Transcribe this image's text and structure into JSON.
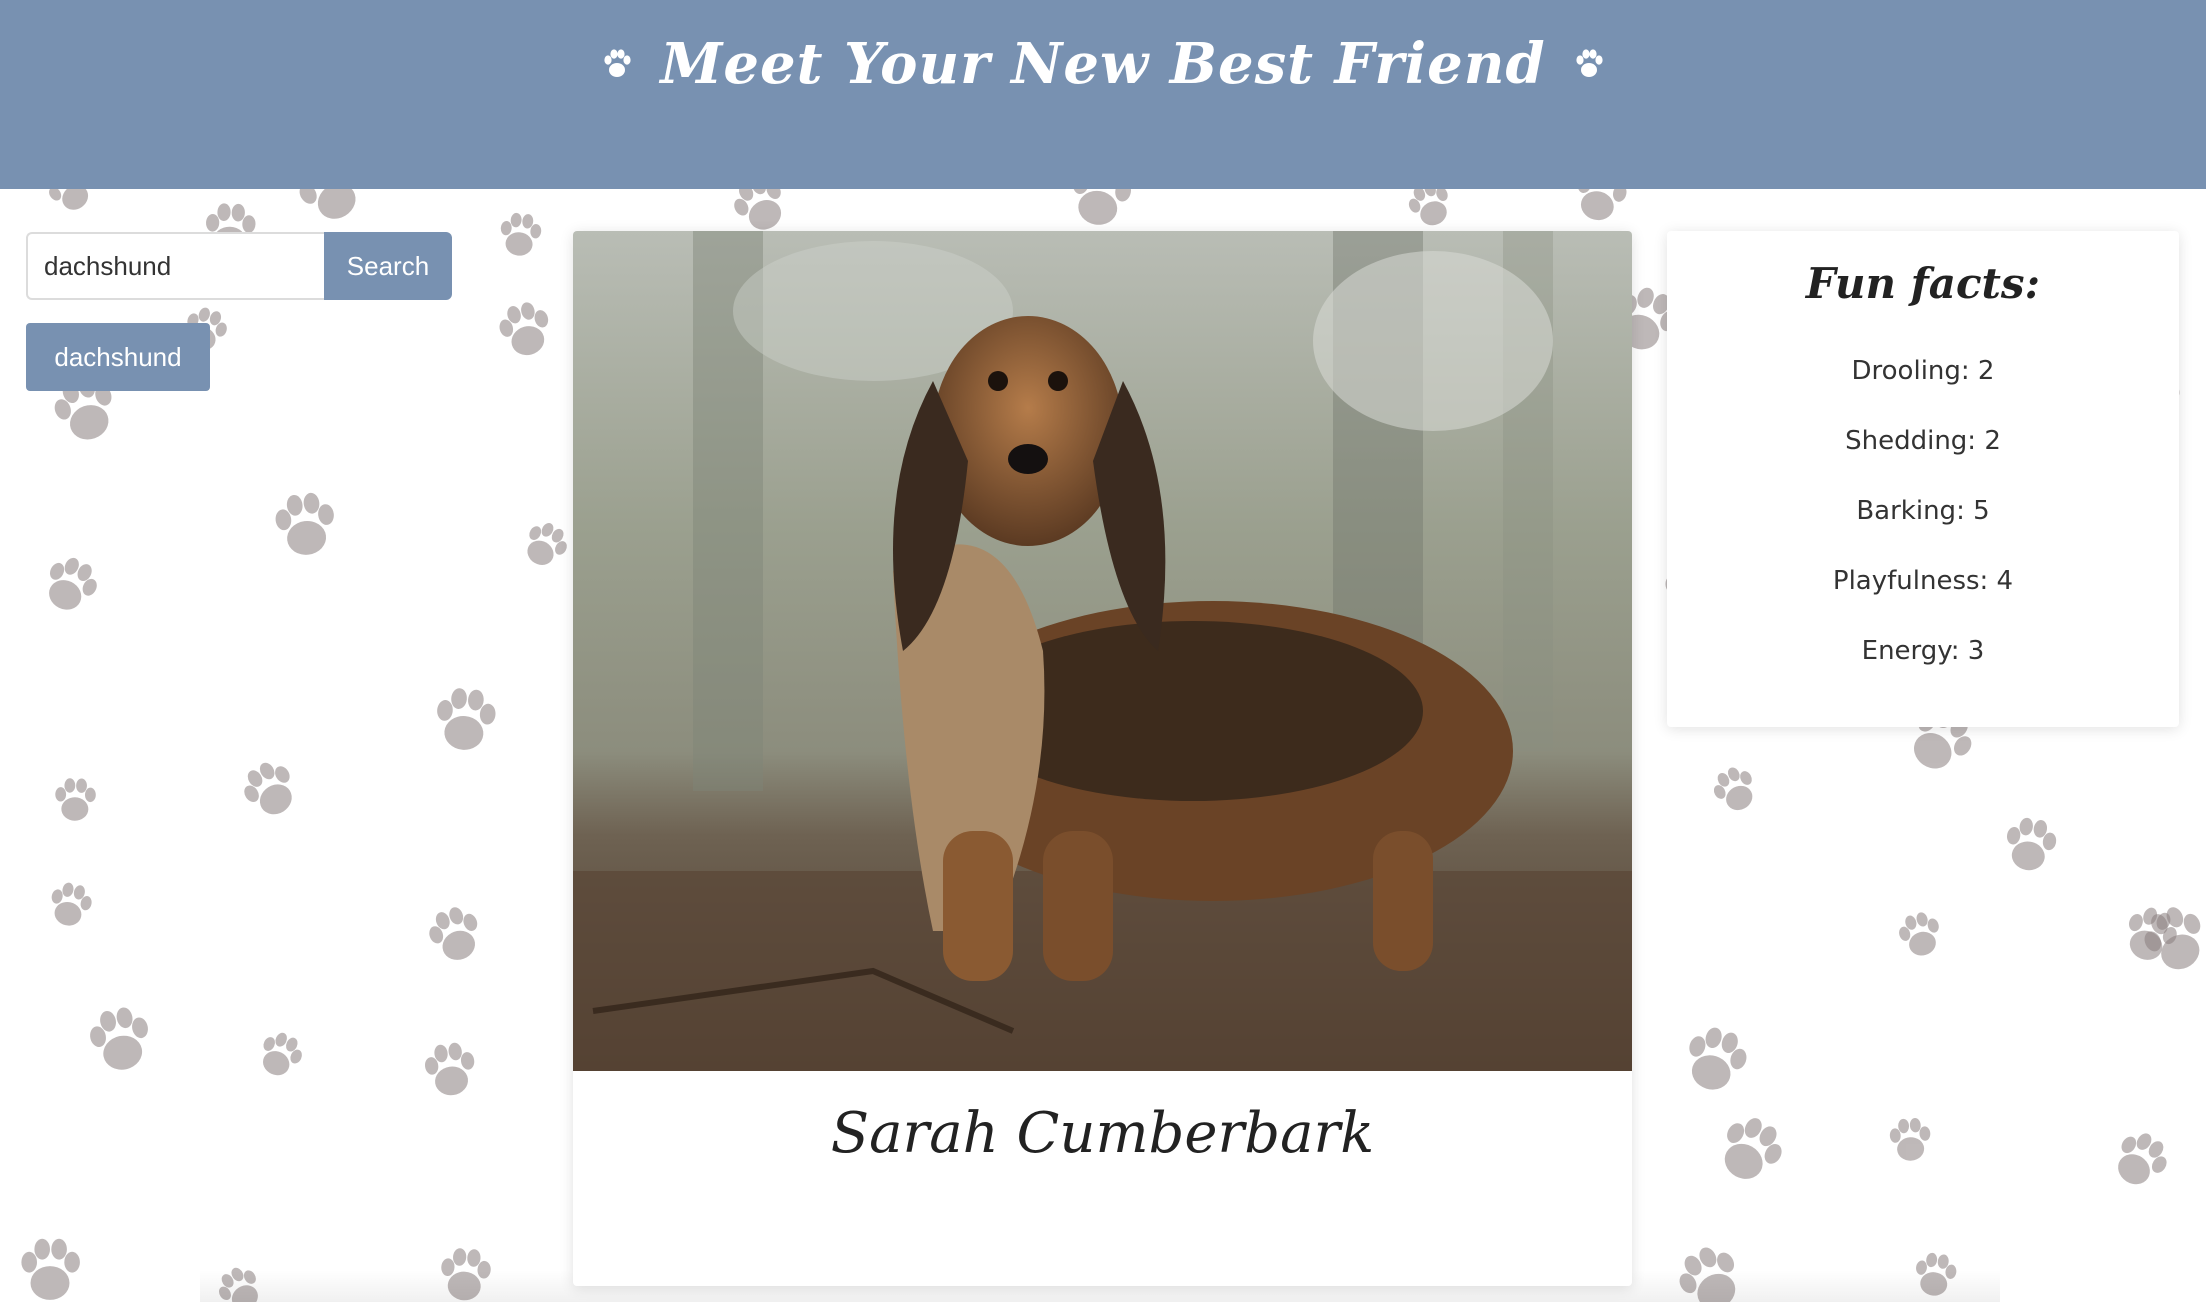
{
  "header": {
    "title": "Meet Your New Best Friend",
    "left_icon": "paw-icon",
    "right_icon": "paw-icon",
    "background_color": "#7891b1"
  },
  "search": {
    "value": "dachshund",
    "button_label": "Search"
  },
  "history": {
    "items": [
      "dachshund"
    ]
  },
  "dog": {
    "name": "Sarah Cumberbark",
    "breed_photo": "long-haired dachshund"
  },
  "facts": {
    "title": "Fun facts:",
    "items": [
      {
        "label": "Drooling: 2"
      },
      {
        "label": "Shedding: 2"
      },
      {
        "label": "Barking: 5"
      },
      {
        "label": "Playfulness: 4"
      },
      {
        "label": "Energy: 3"
      }
    ]
  },
  "colors": {
    "accent": "#7891b1",
    "paw": "#8a7f7f",
    "page_background": "#ffffff"
  }
}
